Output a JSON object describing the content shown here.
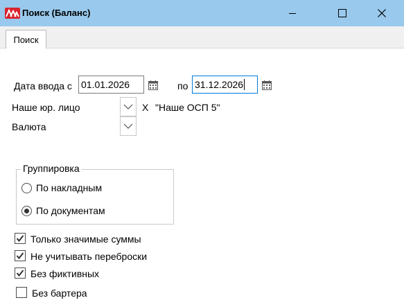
{
  "window": {
    "title": "Поиск (Баланс)"
  },
  "tabs": [
    {
      "label": "Поиск",
      "active": true
    }
  ],
  "form": {
    "date_label": "Дата ввода с",
    "date_from": "01.01.2026",
    "date_to_label": "по",
    "date_to": "31.12.2026",
    "legal_entity_label": "Наше юр. лицо",
    "legal_entity_clear": "X",
    "legal_entity_value": "\"Наше ОСП 5\"",
    "currency_label": "Валюта"
  },
  "grouping": {
    "title": "Группировка",
    "options": [
      {
        "label": "По накладным",
        "selected": false
      },
      {
        "label": "По документам",
        "selected": true
      }
    ]
  },
  "checkboxes": [
    {
      "label": "Только значимые суммы",
      "checked": true
    },
    {
      "label": "Не учитывать переброски",
      "checked": true
    },
    {
      "label": "Без фиктивных",
      "checked": true
    },
    {
      "label": "Без бартера",
      "checked": false
    }
  ],
  "colors": {
    "titlebar": "#99c9ec",
    "focus_border": "#0078d7",
    "app_icon": "#d9232d"
  }
}
